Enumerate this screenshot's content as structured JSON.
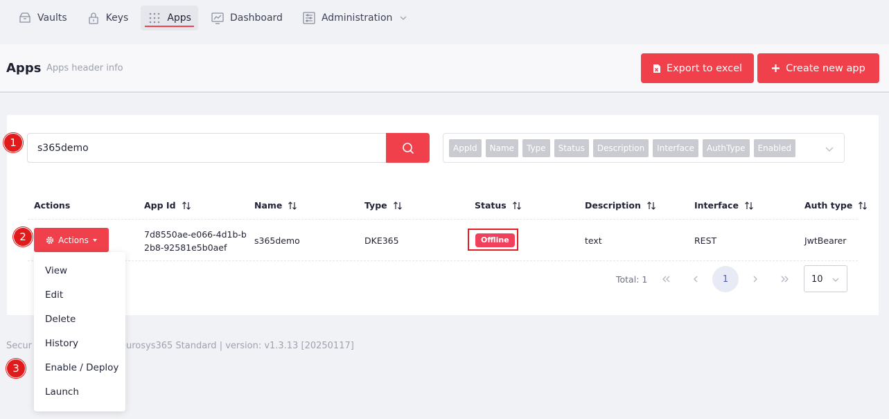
{
  "nav": {
    "items": [
      {
        "label": "Vaults",
        "icon": "vault-icon"
      },
      {
        "label": "Keys",
        "icon": "lock-icon"
      },
      {
        "label": "Apps",
        "icon": "grid-dots-icon",
        "active": true
      },
      {
        "label": "Dashboard",
        "icon": "chart-icon"
      },
      {
        "label": "Administration",
        "icon": "admin-panel-icon",
        "has_dropdown": true
      }
    ]
  },
  "header": {
    "title": "Apps",
    "subtitle": "Apps header info",
    "export_label": "Export to excel",
    "create_label": "Create new app"
  },
  "search": {
    "value": "s365demo"
  },
  "column_filter": {
    "chips": [
      "AppId",
      "Name",
      "Type",
      "Status",
      "Description",
      "Interface",
      "AuthType",
      "Enabled"
    ]
  },
  "table": {
    "columns": [
      "Actions",
      "App Id",
      "Name",
      "Type",
      "Status",
      "Description",
      "Interface",
      "Auth type"
    ],
    "rows": [
      {
        "actions_label": "Actions",
        "app_id_line1": "7d8550ae-e066-4d1b-b",
        "app_id_line2": "2b8-92581e5b0aef",
        "name": "s365demo",
        "type": "DKE365",
        "status": "Offline",
        "description": "text",
        "interface": "REST",
        "auth_type": "JwtBearer"
      }
    ]
  },
  "pagination": {
    "total_label": "Total: 1",
    "current_page": "1",
    "page_size": "10"
  },
  "footer": {
    "text_left": "Secur",
    "text_right": "eurosys365 Standard | version: v1.3.13 [20250117]"
  },
  "actions_menu": {
    "items": [
      "View",
      "Edit",
      "Delete",
      "History",
      "Enable / Deploy",
      "Launch"
    ]
  },
  "markers": [
    "1",
    "2",
    "3"
  ],
  "colors": {
    "accent": "#f0404b",
    "status_offline": "#f0405b",
    "highlight_outline": "#e11b22",
    "pager_current": "#4d5bc9"
  }
}
